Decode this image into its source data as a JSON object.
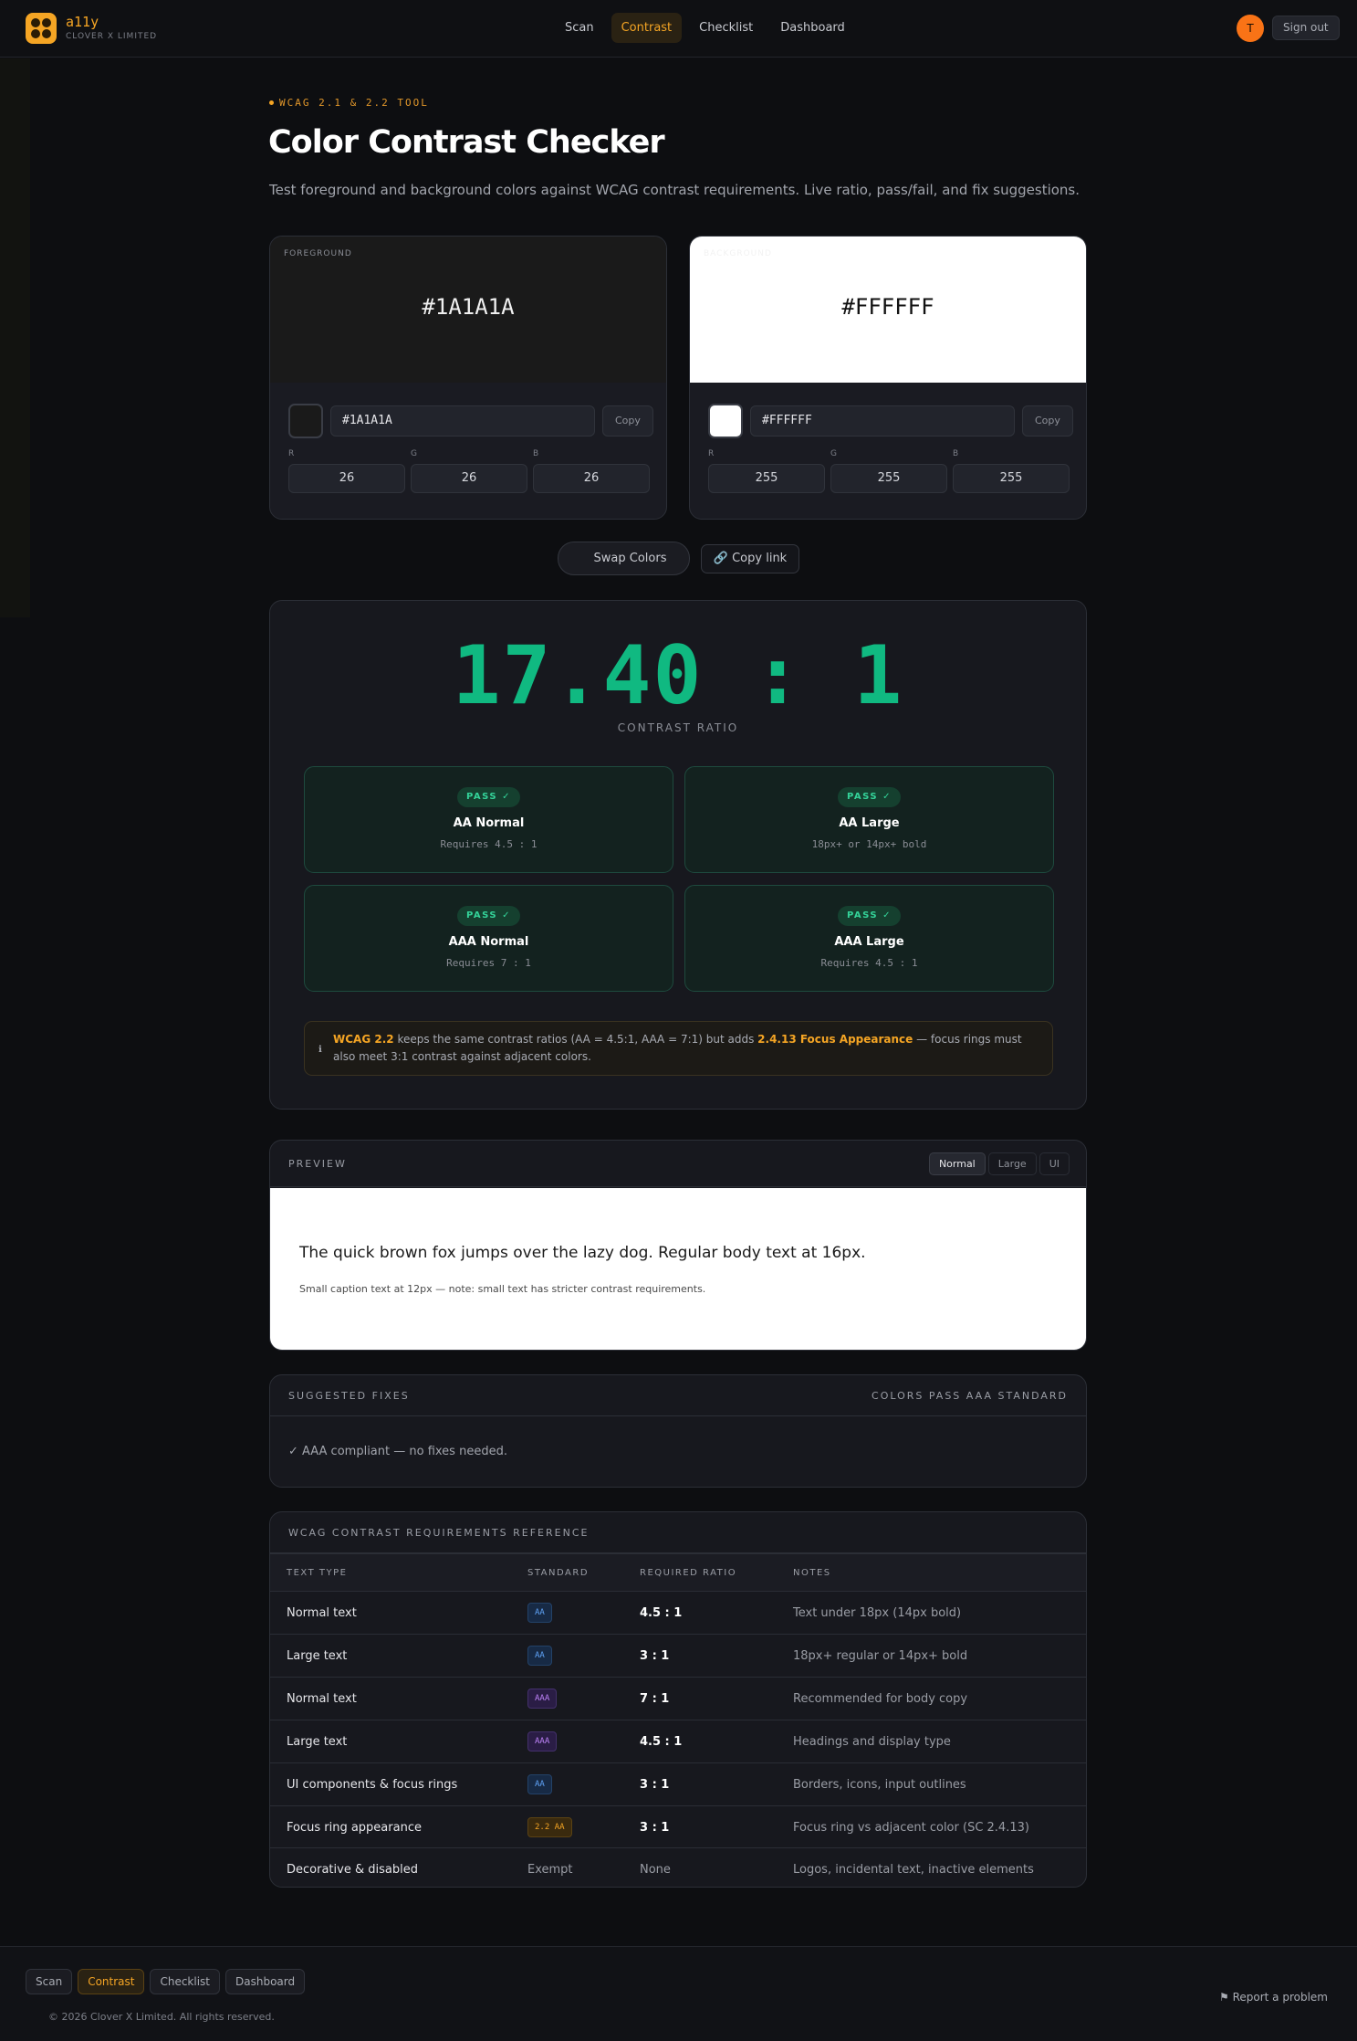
{
  "brand": {
    "name": "a11y",
    "sub": "CLOVER X LIMITED"
  },
  "nav": {
    "links": [
      "Scan",
      "Contrast",
      "Checklist",
      "Dashboard"
    ],
    "active": "Contrast",
    "avatar": "T",
    "signout": "Sign out"
  },
  "header": {
    "eyebrow": "WCAG 2.1 & 2.2 TOOL",
    "title": "Color Contrast Checker",
    "subtitle": "Test foreground and background colors against WCAG contrast requirements. Live ratio, pass/fail, and fix suggestions."
  },
  "foreground": {
    "label": "FOREGROUND",
    "hex": "#1A1A1A",
    "input": "#1A1A1A",
    "copy": "Copy",
    "r": "26",
    "g": "26",
    "b": "26",
    "color": "#1a1a1a"
  },
  "background": {
    "label": "BACKGROUND",
    "hex": "#FFFFFF",
    "input": "#FFFFFF",
    "copy": "Copy",
    "r": "255",
    "g": "255",
    "b": "255",
    "color": "#ffffff"
  },
  "rgb_labels": {
    "r": "R",
    "g": "G",
    "b": "B"
  },
  "actions": {
    "swap": "Swap Colors",
    "copy_link": "Copy link"
  },
  "result": {
    "ratio": "17.40 : 1",
    "ratio_label": "CONTRAST RATIO",
    "checks": [
      {
        "badge": "PASS ✓",
        "name": "AA Normal",
        "req": "Requires 4.5 : 1"
      },
      {
        "badge": "PASS ✓",
        "name": "AA Large",
        "req": "18px+ or 14px+ bold"
      },
      {
        "badge": "PASS ✓",
        "name": "AAA Normal",
        "req": "Requires 7 : 1"
      },
      {
        "badge": "PASS ✓",
        "name": "AAA Large",
        "req": "Requires 4.5 : 1"
      }
    ],
    "note": {
      "lead": "WCAG 2.2",
      "text1": " keeps the same contrast ratios (AA = 4.5:1, AAA = 7:1) but adds ",
      "highlight": "2.4.13 Focus Appearance",
      "text2": " — focus rings must also meet 3:1 contrast against adjacent colors."
    }
  },
  "preview": {
    "label": "PREVIEW",
    "modes": [
      "Normal",
      "Large",
      "UI"
    ],
    "active_mode": "Normal",
    "big_text": "The quick brown fox jumps over the lazy dog. Regular body text at 16px.",
    "small_text": "Small caption text at 12px — note: small text has stricter contrast requirements."
  },
  "fixes": {
    "label": "SUGGESTED FIXES",
    "status": "COLORS PASS AAA STANDARD",
    "message": "✓ AAA compliant — no fixes needed."
  },
  "reference": {
    "title": "WCAG CONTRAST REQUIREMENTS REFERENCE",
    "headers": [
      "TEXT TYPE",
      "STANDARD",
      "REQUIRED RATIO",
      "NOTES"
    ],
    "rows": [
      {
        "type": "Normal text",
        "standard": "AA",
        "kind": "aa",
        "ratio": "4.5 : 1",
        "notes": "Text under 18px (14px bold)"
      },
      {
        "type": "Large text",
        "standard": "AA",
        "kind": "aa",
        "ratio": "3 : 1",
        "notes": "18px+ regular or 14px+ bold"
      },
      {
        "type": "Normal text",
        "standard": "AAA",
        "kind": "aaa",
        "ratio": "7 : 1",
        "notes": "Recommended for body copy"
      },
      {
        "type": "Large text",
        "standard": "AAA",
        "kind": "aaa",
        "ratio": "4.5 : 1",
        "notes": "Headings and display type"
      },
      {
        "type": "UI components & focus rings",
        "standard": "AA",
        "kind": "aa",
        "ratio": "3 : 1",
        "notes": "Borders, icons, input outlines"
      },
      {
        "type": "Focus ring appearance",
        "standard": "2.2 AA",
        "kind": "wc",
        "ratio": "3 : 1",
        "notes": "Focus ring vs adjacent color (SC 2.4.13)"
      },
      {
        "type": "Decorative & disabled",
        "standard": "Exempt",
        "kind": "plain",
        "ratio": "None",
        "notes": "Logos, incidental text, inactive elements"
      }
    ]
  },
  "footer": {
    "links": [
      "Scan",
      "Contrast",
      "Checklist",
      "Dashboard"
    ],
    "active": "Contrast",
    "copyright": "© 2026 Clover X Limited. All rights reserved.",
    "report": "⚑ Report a problem"
  },
  "colors": {
    "accent": "#f5a524",
    "pass": "#10b981",
    "bg": "#0d0e11"
  }
}
